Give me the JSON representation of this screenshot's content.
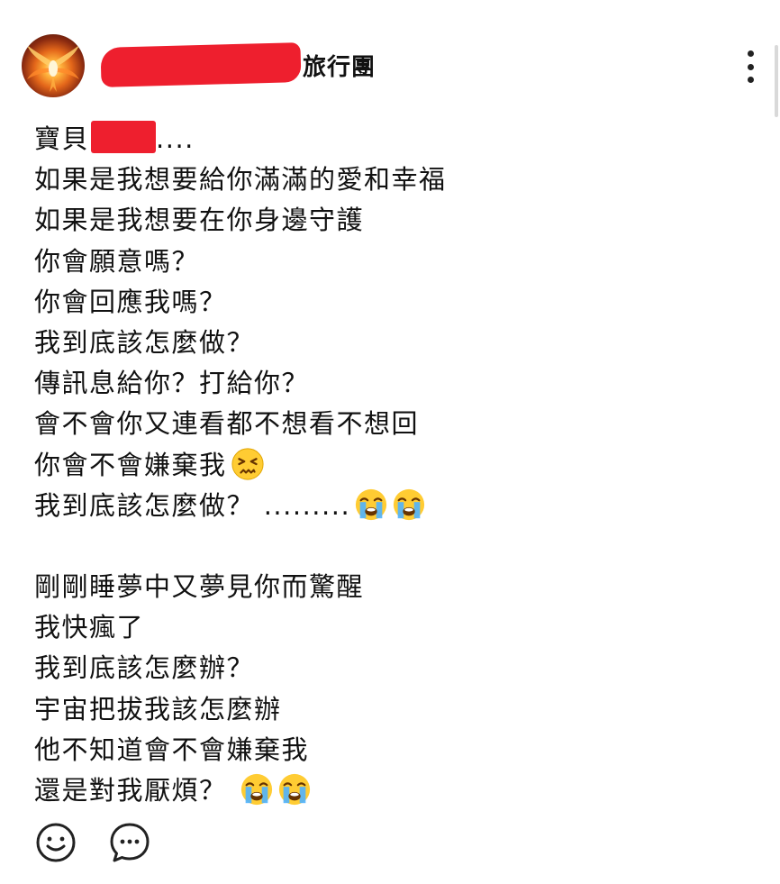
{
  "post": {
    "author_suffix": "旅行團",
    "caption_lines": [
      "寶貝",
      "如果是我想要給你滿滿的愛和幸福",
      "如果是我想要在你身邊守護",
      "你會願意嗎？",
      "你會回應我嗎？",
      "我到底該怎麼做？",
      "傳訊息給你？打給你？",
      "會不會你又連看都不想看不想回",
      "你會不會嫌棄我",
      "我到底該怎麼做？ .........",
      "",
      "剛剛睡夢中又夢見你而驚醒",
      "我快瘋了",
      "我到底該怎麼辦？",
      "宇宙把拔我該怎麼辦",
      "他不知道會不會嫌棄我",
      "還是對我厭煩？ "
    ],
    "line1_suffix": "....",
    "icons": {
      "avatar": "phoenix-fire-avatar",
      "more": "more-vertical-icon",
      "react": "smiley-icon",
      "comment": "comment-bubble-icon",
      "emoji_confounded": "confounded-face-emoji",
      "emoji_crying": "loudly-crying-face-emoji"
    }
  },
  "colors": {
    "redaction": "#ee1f2e",
    "text": "#111111"
  }
}
